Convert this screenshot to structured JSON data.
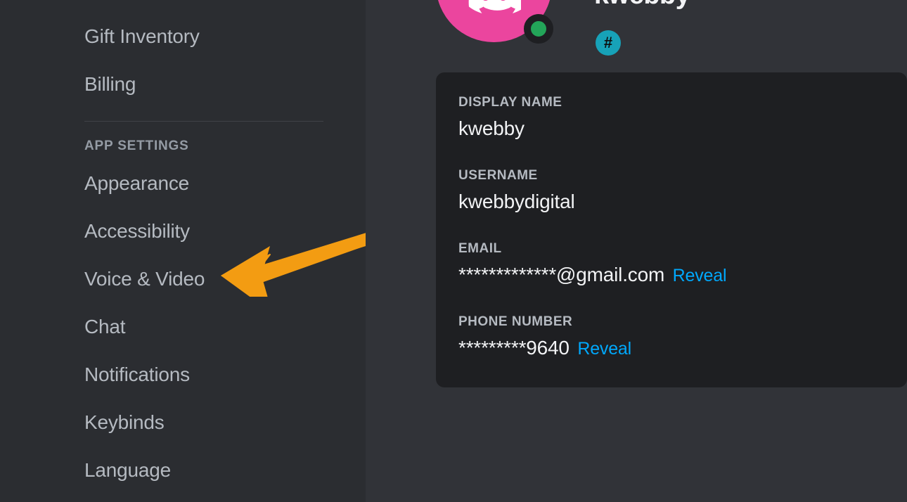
{
  "sidebar": {
    "top_items": [
      "Gift Inventory",
      "Billing"
    ],
    "section_label": "APP SETTINGS",
    "app_items": [
      "Appearance",
      "Accessibility",
      "Voice & Video",
      "Chat",
      "Notifications",
      "Keybinds",
      "Language"
    ]
  },
  "profile": {
    "display_name_top": "kwebby",
    "hash_label": "#",
    "fields": {
      "display_name_label": "DISPLAY NAME",
      "display_name_value": "kwebby",
      "username_label": "USERNAME",
      "username_value": "kwebbydigital",
      "email_label": "EMAIL",
      "email_value": "*************@gmail.com",
      "email_reveal": "Reveal",
      "phone_label": "PHONE NUMBER",
      "phone_value": "*********9640",
      "phone_reveal": "Reveal"
    }
  },
  "colors": {
    "accent_pink": "#eb459e",
    "status_green": "#23a559",
    "link_blue": "#00a8fc",
    "arrow_orange": "#f39c12"
  }
}
